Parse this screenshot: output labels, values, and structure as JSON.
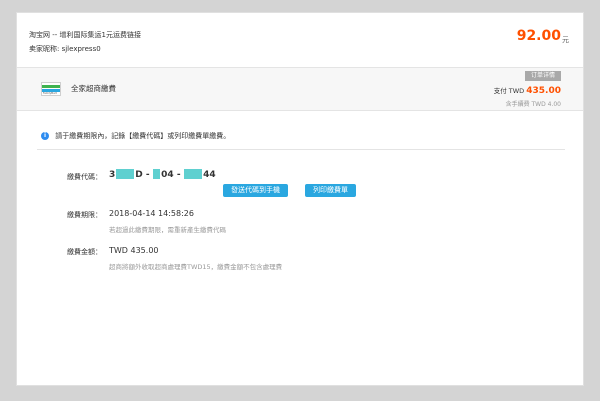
{
  "header": {
    "order_title": "淘宝网 -- 增利国际集运1元运费链接",
    "seller_label": "卖家昵称:",
    "seller_name": "sjlexpress0",
    "price": "92.00",
    "currency": "元"
  },
  "payment_method": {
    "name": "全家超商繳費",
    "logo_text": "FamilyMart",
    "detail_tab": "订单详情",
    "pay_label": "支付",
    "pay_currency": "TWD",
    "pay_amount": "435.00",
    "fee_label": "含手續費 TWD 4.00"
  },
  "instruction": "請于繳費期限內，記錄【繳費代碼】或列印繳費單繳費。",
  "fields": {
    "code_label": "繳費代碼：",
    "code_parts": [
      "3",
      "D -",
      "04 -",
      "44"
    ],
    "send_button": "發送代碼到手機",
    "print_button": "列印繳費單",
    "deadline_label": "繳費期限：",
    "deadline_value": "2018-04-14 14:58:26",
    "deadline_hint": "若超過此繳費期限，需重新產生繳費代碼",
    "amount_label": "繳費金額：",
    "amount_value": "TWD 435.00",
    "amount_hint": "超商將額外收取超商處理費TWD15，繳費金額不包含處理費"
  },
  "colors": {
    "accent": "#ff5000",
    "button": "#2aa7e0",
    "info": "#2d8cf0",
    "mask": "#5fd0d0"
  }
}
